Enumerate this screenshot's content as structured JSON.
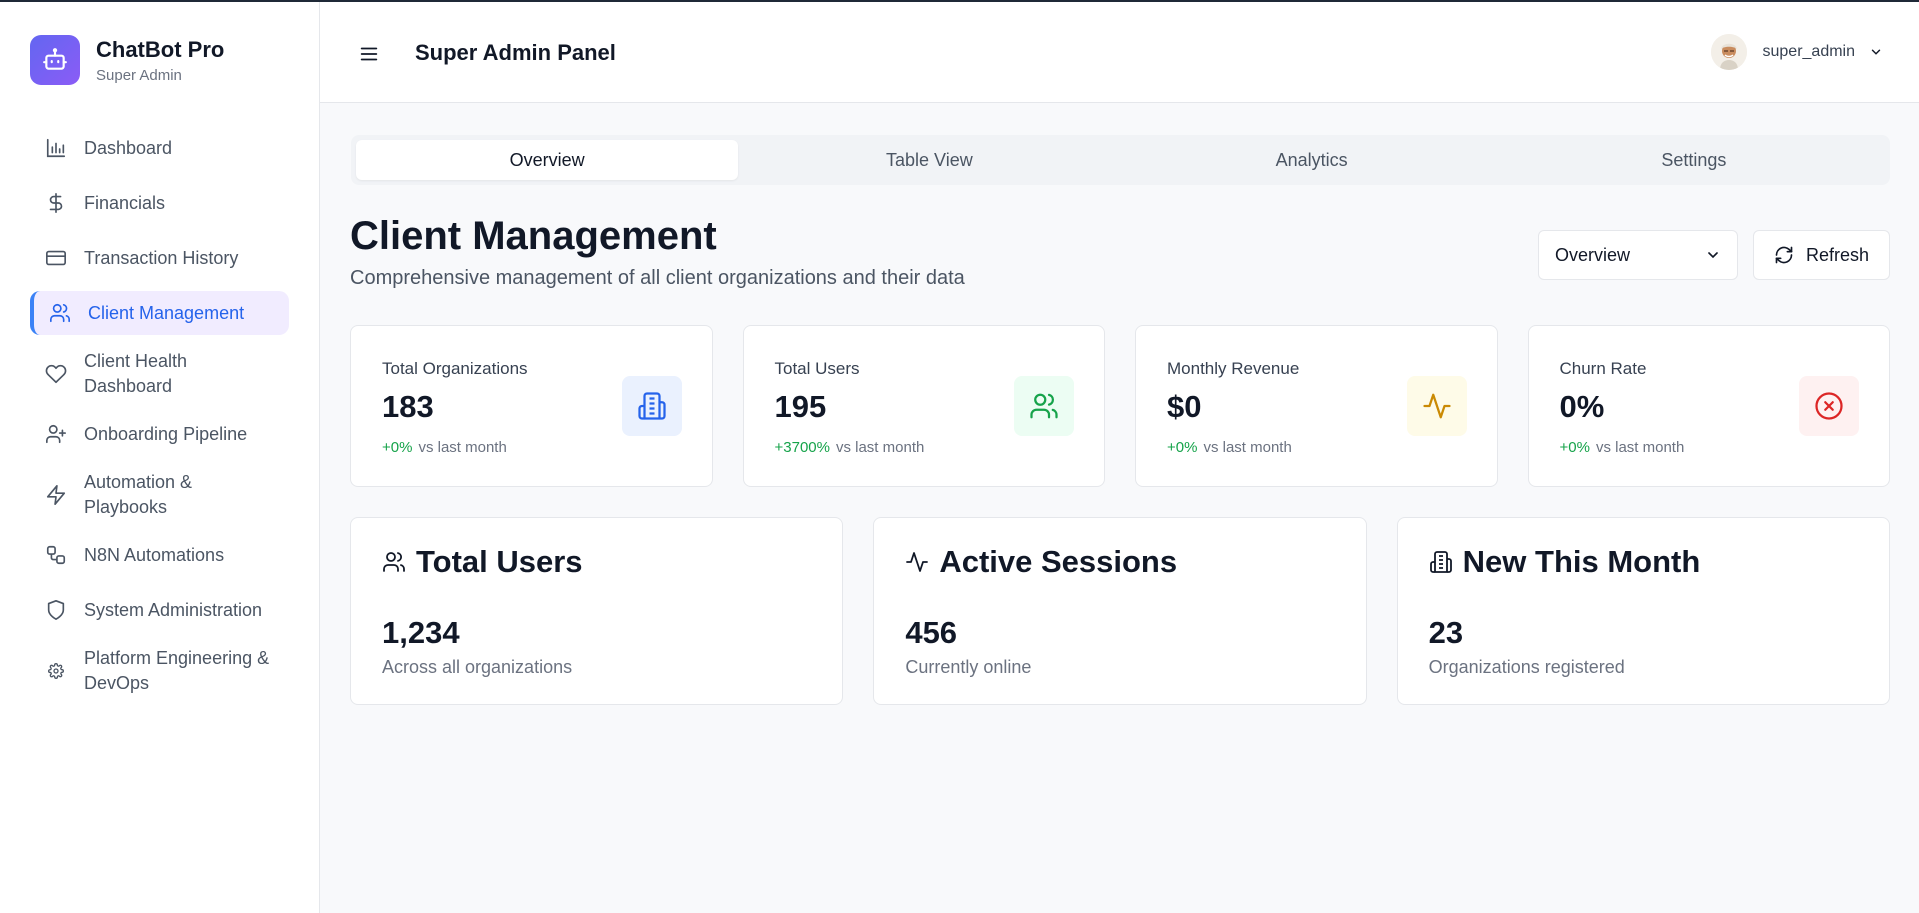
{
  "brand": {
    "name": "ChatBot Pro",
    "subtitle": "Super Admin",
    "logo_icon": "robot-icon",
    "accent": "#6366f1"
  },
  "sidebar": {
    "items": [
      {
        "label": "Dashboard",
        "icon": "bar-chart-icon"
      },
      {
        "label": "Financials",
        "icon": "dollar-icon"
      },
      {
        "label": "Transaction History",
        "icon": "credit-card-icon"
      },
      {
        "label": "Client Management",
        "icon": "users-icon",
        "active": true
      },
      {
        "label": "Client Health Dashboard",
        "icon": "heart-icon"
      },
      {
        "label": "Onboarding Pipeline",
        "icon": "user-plus-icon"
      },
      {
        "label": "Automation & Playbooks",
        "icon": "zap-icon"
      },
      {
        "label": "N8N Automations",
        "icon": "workflow-icon"
      },
      {
        "label": "System Administration",
        "icon": "shield-icon"
      },
      {
        "label": "Platform Engineering & DevOps",
        "icon": "gear-icon"
      }
    ]
  },
  "header": {
    "title": "Super Admin Panel",
    "user": "super_admin"
  },
  "tabs": [
    {
      "label": "Overview",
      "active": true
    },
    {
      "label": "Table View"
    },
    {
      "label": "Analytics"
    },
    {
      "label": "Settings"
    }
  ],
  "page": {
    "title": "Client Management",
    "subtitle": "Comprehensive management of all client organizations and their data",
    "view_select": "Overview",
    "refresh_label": "Refresh"
  },
  "stats": [
    {
      "label": "Total Organizations",
      "value": "183",
      "change": "+0%",
      "change_suffix": "vs last month",
      "icon": "building-icon",
      "color": "#2563eb"
    },
    {
      "label": "Total Users",
      "value": "195",
      "change": "+3700%",
      "change_suffix": "vs last month",
      "icon": "users-icon",
      "color": "#16a34a"
    },
    {
      "label": "Monthly Revenue",
      "value": "$0",
      "change": "+0%",
      "change_suffix": "vs last month",
      "icon": "activity-icon",
      "color": "#ca8a04"
    },
    {
      "label": "Churn Rate",
      "value": "0%",
      "change": "+0%",
      "change_suffix": "vs last month",
      "icon": "x-circle-icon",
      "color": "#dc2626"
    }
  ],
  "cards": [
    {
      "title": "Total Users",
      "value": "1,234",
      "subtitle": "Across all organizations",
      "icon": "users-icon"
    },
    {
      "title": "Active Sessions",
      "value": "456",
      "subtitle": "Currently online",
      "icon": "activity-icon"
    },
    {
      "title": "New This Month",
      "value": "23",
      "subtitle": "Organizations registered",
      "icon": "building-icon"
    }
  ]
}
